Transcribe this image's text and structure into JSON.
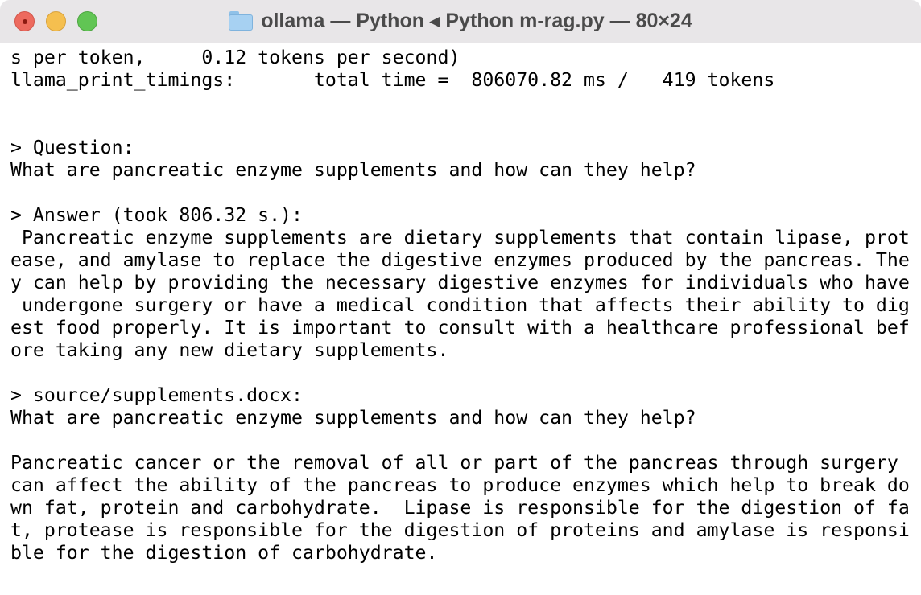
{
  "window": {
    "title": "ollama — Python ◂ Python m-rag.py — 80×24",
    "folder_icon": "folder-icon"
  },
  "colors": {
    "close": "#ed6a5e",
    "minimize": "#f5bf4f",
    "zoom": "#61c554",
    "titlebar": "#e8e6e8"
  },
  "terminal": {
    "lines": [
      "s per token,     0.12 tokens per second)",
      "llama_print_timings:       total time =  806070.82 ms /   419 tokens",
      "",
      "",
      "> Question:",
      "What are pancreatic enzyme supplements and how can they help?",
      "",
      "> Answer (took 806.32 s.):",
      " Pancreatic enzyme supplements are dietary supplements that contain lipase, prot",
      "ease, and amylase to replace the digestive enzymes produced by the pancreas. The",
      "y can help by providing the necessary digestive enzymes for individuals who have",
      " undergone surgery or have a medical condition that affects their ability to dig",
      "est food properly. It is important to consult with a healthcare professional bef",
      "ore taking any new dietary supplements.",
      "",
      "> source/supplements.docx:",
      "What are pancreatic enzyme supplements and how can they help?",
      "",
      "Pancreatic cancer or the removal of all or part of the pancreas through surgery ",
      "can affect the ability of the pancreas to produce enzymes which help to break do",
      "wn fat, protein and carbohydrate.  Lipase is responsible for the digestion of fa",
      "t, protease is responsible for the digestion of proteins and amylase is responsi",
      "ble for the digestion of carbohydrate.",
      ""
    ]
  }
}
